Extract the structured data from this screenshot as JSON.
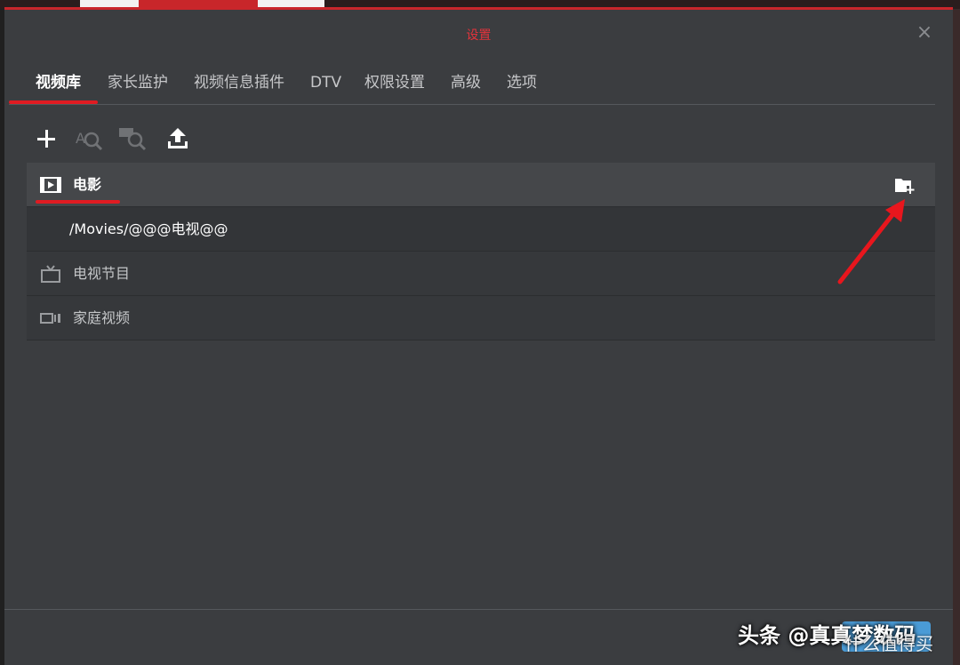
{
  "dialog": {
    "title": "设置",
    "close_label": "×"
  },
  "tabs": [
    {
      "label": "视频库",
      "active": true
    },
    {
      "label": "家长监护",
      "active": false
    },
    {
      "label": "视频信息插件",
      "active": false
    },
    {
      "label": "DTV",
      "active": false
    },
    {
      "label": "权限设置",
      "active": false
    },
    {
      "label": "高级",
      "active": false
    },
    {
      "label": "选项",
      "active": false
    }
  ],
  "toolbar": {
    "icons": [
      "plus-icon",
      "scan-icon",
      "rescan-icon",
      "upload-icon"
    ]
  },
  "libraries": [
    {
      "label": "电影",
      "icon": "film-icon",
      "expanded": true,
      "paths": [
        "/Movies/@@@电视@@"
      ]
    },
    {
      "label": "电视节目",
      "icon": "tv-icon"
    },
    {
      "label": "家庭视频",
      "icon": "video-camera-icon"
    }
  ],
  "watermark": {
    "text": "头条 @真真梦数码",
    "secondary": "什么值得买"
  },
  "colors": {
    "accent_red": "#e01b22",
    "dialog_bg": "#3b3d40",
    "title_red": "#e5333b"
  }
}
